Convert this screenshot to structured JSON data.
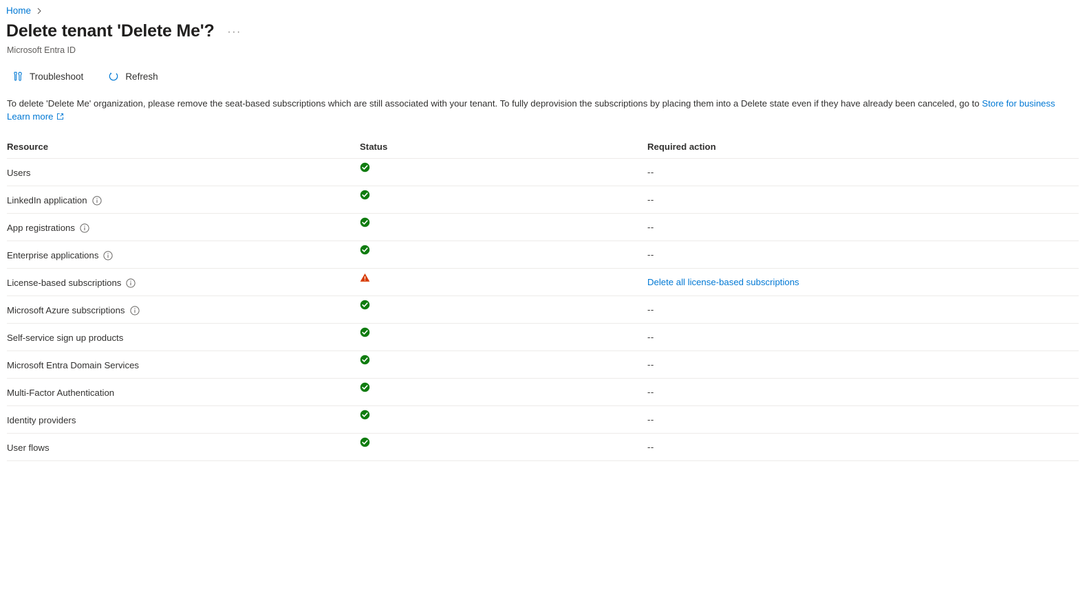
{
  "breadcrumb": {
    "home_label": "Home",
    "separator_icon": "chevron-right-icon"
  },
  "header": {
    "title": "Delete tenant 'Delete Me'?",
    "subtitle": "Microsoft Entra ID",
    "more_label": "···"
  },
  "toolbar": {
    "troubleshoot_label": "Troubleshoot",
    "refresh_label": "Refresh"
  },
  "description": {
    "text_before_link": "To delete 'Delete Me' organization, please remove the seat-based subscriptions which are still associated with your tenant. To fully deprovision the subscriptions by placing them into a Delete state even if they have already been canceled, go to ",
    "store_link": "Store for business",
    "learn_more": "Learn more"
  },
  "table": {
    "columns": [
      "Resource",
      "Status",
      "Required action"
    ],
    "rows": [
      {
        "resource": "Users",
        "info": false,
        "status": "ok",
        "action": "--",
        "action_is_link": false
      },
      {
        "resource": "LinkedIn application",
        "info": true,
        "status": "ok",
        "action": "--",
        "action_is_link": false
      },
      {
        "resource": "App registrations",
        "info": true,
        "status": "ok",
        "action": "--",
        "action_is_link": false
      },
      {
        "resource": "Enterprise applications",
        "info": true,
        "status": "ok",
        "action": "--",
        "action_is_link": false
      },
      {
        "resource": "License-based subscriptions",
        "info": true,
        "status": "warning",
        "action": "Delete all license-based subscriptions",
        "action_is_link": true
      },
      {
        "resource": "Microsoft Azure subscriptions",
        "info": true,
        "status": "ok",
        "action": "--",
        "action_is_link": false
      },
      {
        "resource": "Self-service sign up products",
        "info": false,
        "status": "ok",
        "action": "--",
        "action_is_link": false
      },
      {
        "resource": "Microsoft Entra Domain Services",
        "info": false,
        "status": "ok",
        "action": "--",
        "action_is_link": false
      },
      {
        "resource": "Multi-Factor Authentication",
        "info": false,
        "status": "ok",
        "action": "--",
        "action_is_link": false
      },
      {
        "resource": "Identity providers",
        "info": false,
        "status": "ok",
        "action": "--",
        "action_is_link": false
      },
      {
        "resource": "User flows",
        "info": false,
        "status": "ok",
        "action": "--",
        "action_is_link": false
      }
    ]
  },
  "colors": {
    "link": "#0078d4",
    "success": "#107c10",
    "warning": "#d83b01",
    "border": "#edebe9",
    "text": "#323130",
    "subtle": "#605e5c"
  }
}
